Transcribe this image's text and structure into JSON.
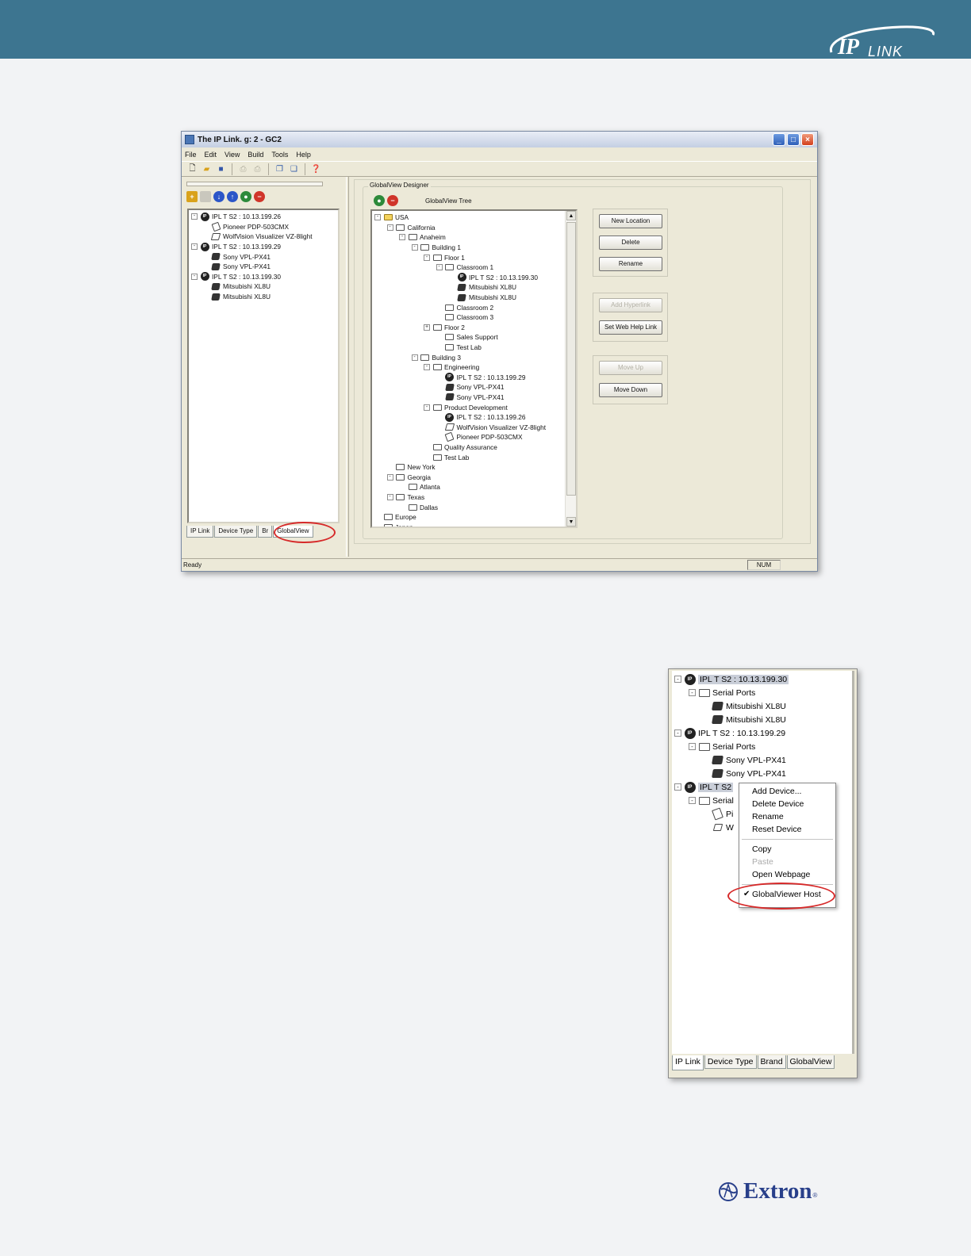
{
  "brand": {
    "logo_ip": "IP",
    "logo_link": "LINK",
    "footer_logo": "Extron",
    "footer_reg": "®"
  },
  "main_window": {
    "title": "The IP Link. g: 2 - GC2",
    "menu": [
      "File",
      "Edit",
      "View",
      "Build",
      "Tools",
      "Help"
    ],
    "left_tree": [
      {
        "depth": 0,
        "exp": "-",
        "icon": "ip",
        "label": "IPL T S2 : 10.13.199.26"
      },
      {
        "depth": 1,
        "exp": "",
        "icon": "doc",
        "label": "Pioneer PDP-503CMX"
      },
      {
        "depth": 1,
        "exp": "",
        "icon": "disp",
        "label": "WolfVision Visualizer VZ-8light"
      },
      {
        "depth": 0,
        "exp": "-",
        "icon": "ip",
        "label": "IPL T S2 : 10.13.199.29"
      },
      {
        "depth": 1,
        "exp": "",
        "icon": "proj",
        "label": "Sony VPL-PX41"
      },
      {
        "depth": 1,
        "exp": "",
        "icon": "proj",
        "label": "Sony VPL-PX41"
      },
      {
        "depth": 0,
        "exp": "-",
        "icon": "ip",
        "label": "IPL T S2 : 10.13.199.30"
      },
      {
        "depth": 1,
        "exp": "",
        "icon": "proj",
        "label": "Mitsubishi XL8U"
      },
      {
        "depth": 1,
        "exp": "",
        "icon": "proj",
        "label": "Mitsubishi XL8U"
      }
    ],
    "left_tabs": [
      "IP Link",
      "Device Type",
      "Br",
      "GlobalView"
    ],
    "designer": {
      "group_label": "GlobalView Designer",
      "tree_title": "GlobalView Tree",
      "tree": [
        {
          "depth": 0,
          "exp": "-",
          "icon": "folder-open",
          "label": "USA"
        },
        {
          "depth": 1,
          "exp": "-",
          "icon": "folder",
          "label": "California"
        },
        {
          "depth": 2,
          "exp": "-",
          "icon": "folder",
          "label": "Anaheim"
        },
        {
          "depth": 3,
          "exp": "-",
          "icon": "folder",
          "label": "Building 1"
        },
        {
          "depth": 4,
          "exp": "-",
          "icon": "folder",
          "label": "Floor 1"
        },
        {
          "depth": 5,
          "exp": "-",
          "icon": "folder",
          "label": "Classroom 1"
        },
        {
          "depth": 6,
          "exp": "",
          "icon": "ip",
          "label": "IPL T S2 : 10.13.199.30"
        },
        {
          "depth": 6,
          "exp": "",
          "icon": "proj",
          "label": "Mitsubishi XL8U"
        },
        {
          "depth": 6,
          "exp": "",
          "icon": "proj",
          "label": "Mitsubishi XL8U"
        },
        {
          "depth": 5,
          "exp": "",
          "icon": "folder",
          "label": "Classroom 2"
        },
        {
          "depth": 5,
          "exp": "",
          "icon": "folder",
          "label": "Classroom 3"
        },
        {
          "depth": 4,
          "exp": "+",
          "icon": "folder",
          "label": "Floor 2"
        },
        {
          "depth": 5,
          "exp": "",
          "icon": "folder",
          "label": "Sales Support"
        },
        {
          "depth": 5,
          "exp": "",
          "icon": "folder",
          "label": "Test Lab"
        },
        {
          "depth": 3,
          "exp": "-",
          "icon": "folder",
          "label": "Building 3"
        },
        {
          "depth": 4,
          "exp": "-",
          "icon": "folder",
          "label": "Engineering"
        },
        {
          "depth": 5,
          "exp": "",
          "icon": "ip",
          "label": "IPL T S2 : 10.13.199.29"
        },
        {
          "depth": 5,
          "exp": "",
          "icon": "proj",
          "label": "Sony VPL-PX41"
        },
        {
          "depth": 5,
          "exp": "",
          "icon": "proj",
          "label": "Sony VPL-PX41"
        },
        {
          "depth": 4,
          "exp": "-",
          "icon": "folder",
          "label": "Product Development"
        },
        {
          "depth": 5,
          "exp": "",
          "icon": "ip",
          "label": "IPL T S2 : 10.13.199.26"
        },
        {
          "depth": 5,
          "exp": "",
          "icon": "disp",
          "label": "WolfVision Visualizer VZ-8light"
        },
        {
          "depth": 5,
          "exp": "",
          "icon": "doc",
          "label": "Pioneer PDP-503CMX"
        },
        {
          "depth": 4,
          "exp": "",
          "icon": "folder",
          "label": "Quality Assurance"
        },
        {
          "depth": 4,
          "exp": "",
          "icon": "folder",
          "label": "Test Lab"
        },
        {
          "depth": 1,
          "exp": "",
          "icon": "folder",
          "label": "New York"
        },
        {
          "depth": 1,
          "exp": "-",
          "icon": "folder",
          "label": "Georgia"
        },
        {
          "depth": 2,
          "exp": "",
          "icon": "folder",
          "label": "Atlanta"
        },
        {
          "depth": 1,
          "exp": "-",
          "icon": "folder",
          "label": "Texas"
        },
        {
          "depth": 2,
          "exp": "",
          "icon": "folder",
          "label": "Dallas"
        },
        {
          "depth": 0,
          "exp": "",
          "icon": "folder",
          "label": "Europe"
        },
        {
          "depth": 0,
          "exp": "",
          "icon": "folder",
          "label": "Japan"
        }
      ],
      "buttons": {
        "new_location": "New Location",
        "delete": "Delete",
        "rename": "Rename",
        "add_hyperlink": "Add Hyperlink",
        "set_web_help_link": "Set Web Help Link",
        "move_up": "Move Up",
        "move_down": "Move Down"
      }
    },
    "status": {
      "text": "Ready",
      "num": "NUM"
    }
  },
  "context_window": {
    "tree": [
      {
        "depth": 0,
        "exp": "-",
        "icon": "ip",
        "label": "IPL T S2 : 10.13.199.30",
        "hl": true
      },
      {
        "depth": 1,
        "exp": "-",
        "icon": "folder",
        "label": "Serial Ports"
      },
      {
        "depth": 2,
        "exp": "",
        "icon": "proj",
        "label": "Mitsubishi XL8U"
      },
      {
        "depth": 2,
        "exp": "",
        "icon": "proj",
        "label": "Mitsubishi XL8U"
      },
      {
        "depth": 0,
        "exp": "-",
        "icon": "ip",
        "label": "IPL T S2 : 10.13.199.29"
      },
      {
        "depth": 1,
        "exp": "-",
        "icon": "folder",
        "label": "Serial Ports"
      },
      {
        "depth": 2,
        "exp": "",
        "icon": "proj",
        "label": "Sony VPL-PX41"
      },
      {
        "depth": 2,
        "exp": "",
        "icon": "proj",
        "label": "Sony VPL-PX41"
      },
      {
        "depth": 0,
        "exp": "-",
        "icon": "ip",
        "label": "IPL T S2",
        "hl": true
      },
      {
        "depth": 1,
        "exp": "-",
        "icon": "folder",
        "label": "Serial"
      },
      {
        "depth": 2,
        "exp": "",
        "icon": "doc",
        "label": "Pi"
      },
      {
        "depth": 2,
        "exp": "",
        "icon": "disp",
        "label": "W"
      }
    ],
    "menu": {
      "add_device": "Add Device...",
      "delete_device": "Delete Device",
      "rename": "Rename",
      "reset_device": "Reset Device",
      "copy": "Copy",
      "paste": "Paste",
      "open_webpage": "Open Webpage",
      "globalviewer_host": "GlobalViewer Host",
      "check": "✔"
    },
    "tabs": [
      "IP Link",
      "Device Type",
      "Brand",
      "GlobalView"
    ]
  },
  "colors": {
    "banner": "#3d7590",
    "highlight_circle": "#d62a2a",
    "extron_blue": "#283f8a"
  }
}
